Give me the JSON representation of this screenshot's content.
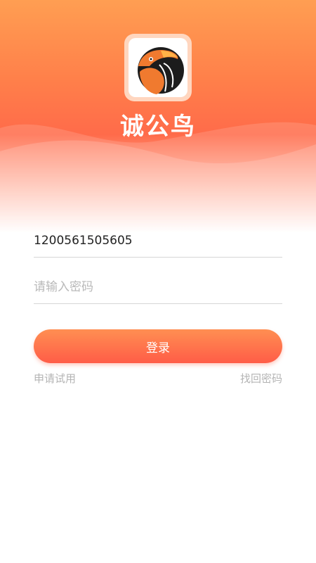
{
  "app": {
    "name": "诚公鸟",
    "logo_icon": "toucan-bird-logo-icon"
  },
  "form": {
    "account_value": "1200561505605",
    "password_placeholder": "请输入密码",
    "login_label": "登录"
  },
  "links": {
    "apply_trial": "申请试用",
    "forgot_password": "找回密码"
  },
  "colors": {
    "brand_orange": "#ff7f4a",
    "button_gradient_top": "#ff8f52",
    "button_gradient_bottom": "#ff5c47",
    "link_gray": "#b4b4b4"
  }
}
